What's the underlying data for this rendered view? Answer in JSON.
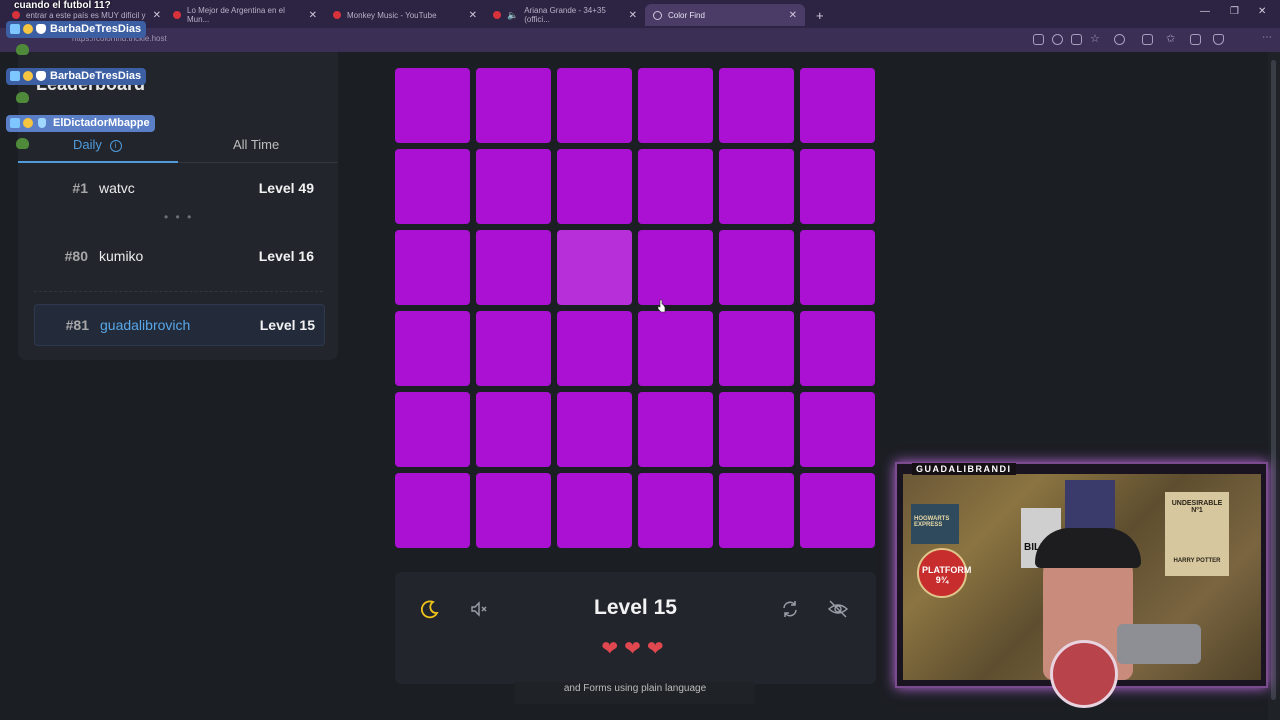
{
  "browser": {
    "tabs": [
      {
        "label": "entrar a este país es MUY difícil y"
      },
      {
        "label": "Lo Mejor de Argentina en el Mun..."
      },
      {
        "label": "Monkey Music - YouTube"
      },
      {
        "label": "Ariana Grande - 34+35 (offici..."
      },
      {
        "label": "Color Find"
      }
    ],
    "url": "https://colorfind.trickle.host",
    "new_tab": "+"
  },
  "chat": {
    "top_line": "cuando el futbol 11?",
    "names": [
      "BarbaDeTresDias",
      "BarbaDeTresDias",
      "ElDictadorMbappe"
    ],
    "badge_count": "1"
  },
  "leaderboard": {
    "title": "Leaderboard",
    "tabs": {
      "daily": "Daily",
      "all_time": "All Time"
    },
    "info_icon": "i",
    "ellipsis": "• • •",
    "rows": [
      {
        "rank": "#1",
        "name": "watvc",
        "level": "Level 49"
      },
      {
        "rank": "#80",
        "name": "kumiko",
        "level": "Level 16"
      },
      {
        "rank": "#81",
        "name": "guadalibrovich",
        "level": "Level 15"
      }
    ]
  },
  "game": {
    "grid_color": "#aa11d3",
    "odd_color": "#b72fd9",
    "odd_index": 14,
    "grid_size": 6,
    "level": "Level 15",
    "hearts": "❤❤❤",
    "lives": 3,
    "icons": [
      "moon-icon",
      "mute-icon",
      "refresh-icon",
      "eye-off-icon"
    ],
    "footer": "and Forms using plain language"
  },
  "webcam": {
    "label": "GUADALIBRANDI",
    "posters": [
      "HOGWARTS EXPRESS",
      "PLATFORM 9¾",
      "BILLIE",
      "UNDESIRABLE Nº1",
      "HARRY POTTER"
    ]
  }
}
